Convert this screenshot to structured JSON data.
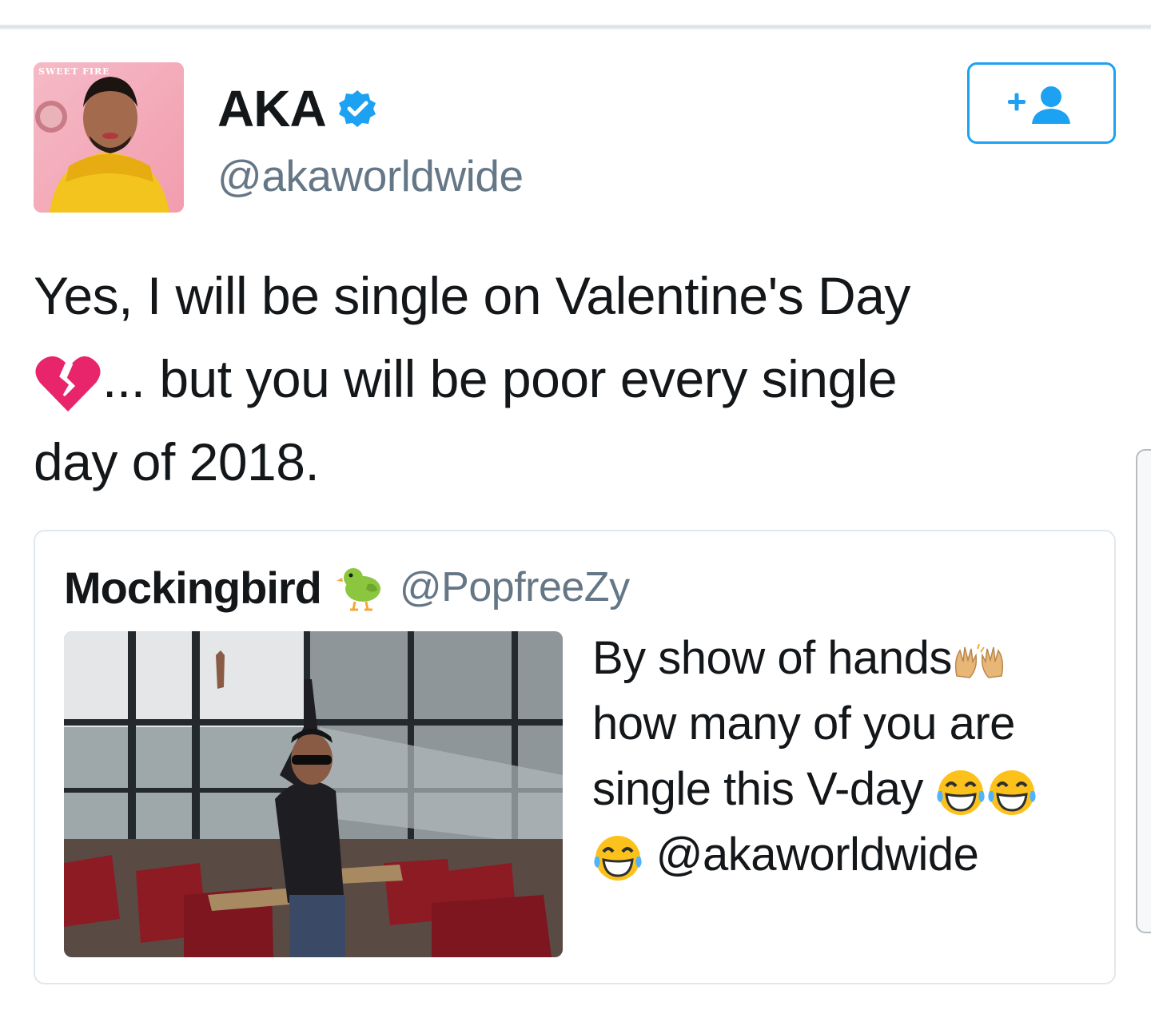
{
  "user": {
    "display_name": "AKA",
    "handle": "@akaworldwide",
    "avatar_caption": "SWEET FIRE"
  },
  "follow_button": {
    "icon": "add-user-icon"
  },
  "tweet": {
    "lines": [
      "Yes, I will be single on Valentine's Day",
      "... but you will be poor every single",
      "day of 2018."
    ],
    "emoji": "broken-heart"
  },
  "quoted_tweet": {
    "display_name": "Mockingbird",
    "name_emoji": "baby-chick",
    "handle": "@PopfreeZy",
    "text_lines": [
      "By show of hands",
      "how many of you are",
      "single this V-day",
      "@akaworldwide"
    ],
    "emojis": [
      "raised-hands",
      "tears-of-joy",
      "tears-of-joy",
      "tears-of-joy"
    ]
  },
  "colors": {
    "accent": "#1da1f2",
    "text": "#14171a",
    "muted": "#657786",
    "border": "#e1e8ed"
  }
}
